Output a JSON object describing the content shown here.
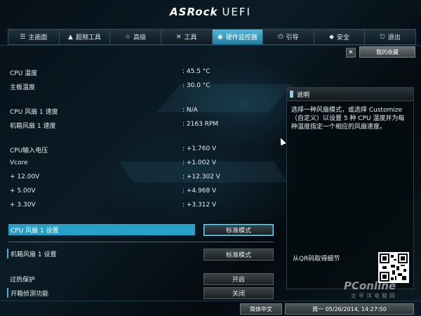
{
  "header": {
    "brand": "ASRock",
    "product": "UEFI"
  },
  "tabs": [
    {
      "label": "主画面",
      "icon": "list-icon"
    },
    {
      "label": "超频工具",
      "icon": "rocket-icon"
    },
    {
      "label": "高级",
      "icon": "star-icon"
    },
    {
      "label": "工具",
      "icon": "wrench-icon"
    },
    {
      "label": "硬件监控器",
      "icon": "monitor-icon",
      "active": true
    },
    {
      "label": "引导",
      "icon": "power-icon"
    },
    {
      "label": "安全",
      "icon": "shield-icon"
    },
    {
      "label": "退出",
      "icon": "exit-icon"
    }
  ],
  "favorites": {
    "label": "我的收藏"
  },
  "readings": [
    {
      "label": "CPU 温度",
      "value": ": 45.5 °C"
    },
    {
      "label": "主板温度",
      "value": ": 30.0 °C"
    },
    {
      "label": "CPU 风扇 1 速度",
      "value": ": N/A"
    },
    {
      "label": "机箱风扇 1 速度",
      "value": ": 2163 RPM"
    },
    {
      "label": "CPU输入电压",
      "value": ": +1.760 V"
    },
    {
      "label": "Vcore",
      "value": ": +1.002 V"
    },
    {
      "label": "+ 12.00V",
      "value": ": +12.302 V"
    },
    {
      "label": "+ 5.00V",
      "value": ": +4.968 V"
    },
    {
      "label": "+ 3.30V",
      "value": ": +3.312 V"
    }
  ],
  "settings": [
    {
      "label": "CPU 风扇 1 设置",
      "value": "标准模式"
    },
    {
      "label": "机箱风扇 1 设置",
      "value": "标准模式"
    },
    {
      "label": "过热保护",
      "value": "开启"
    },
    {
      "label": "开箱侦测功能",
      "value": "关闭"
    }
  ],
  "description": {
    "title": "说明",
    "text": "选择一种风扇模式，或选择 Customize（自定义）以设置 5 种 CPU 温度并为每种温度指定一个相应的风扇速度。",
    "qr_label": "从QR码取得细节"
  },
  "statusbar": {
    "language": "简体中文",
    "datetime": "周一 05/26/2014, 14:27:50"
  },
  "watermark": {
    "site": "PConline",
    "sub": "太平洋电脑网"
  },
  "colors": {
    "accent": "#26a0c6",
    "active_tab": "#3aa6cc"
  }
}
